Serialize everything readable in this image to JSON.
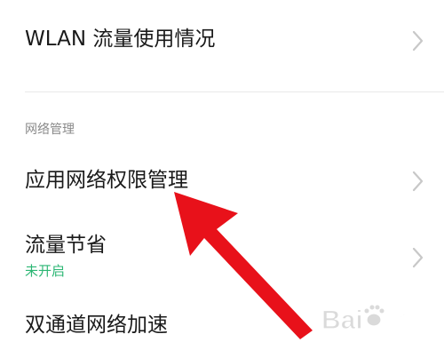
{
  "items": {
    "wlan_usage": {
      "label": "WLAN 流量使用情况"
    },
    "section_network": {
      "label": "网络管理"
    },
    "app_permissions": {
      "label": "应用网络权限管理"
    },
    "data_saver": {
      "label": "流量节省",
      "status": "未开启"
    },
    "dual_channel": {
      "label": "双通道网络加速"
    }
  },
  "icons": {
    "chevron": "chevron-right-icon",
    "arrow": "red-arrow-annotation",
    "watermark": "baidu-jingyan-watermark"
  },
  "colors": {
    "text": "#1a1a1a",
    "section_header": "#8a8a8a",
    "status_on": "#2bb673",
    "chevron": "#c8c8c8",
    "arrow": "#e8111a",
    "divider": "#e9e9e9"
  },
  "watermark": {
    "text": "Bai经验"
  }
}
